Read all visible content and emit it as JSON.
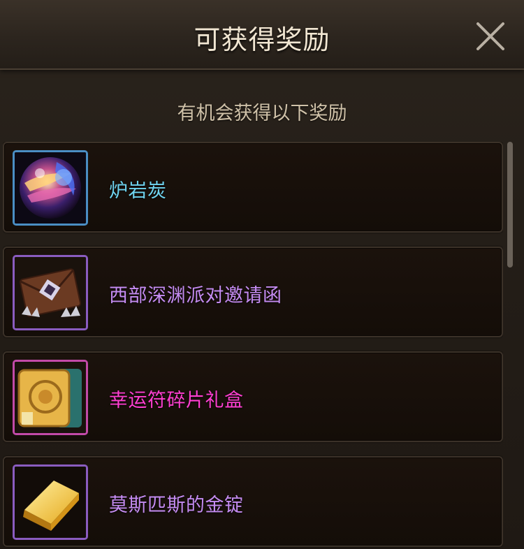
{
  "dialog": {
    "title": "可获得奖励",
    "subtitle": "有机会获得以下奖励",
    "close_icon": "close-icon"
  },
  "rewards": [
    {
      "name": "炉岩炭",
      "icon": "orb-icon",
      "rarity_color": "#6fd3ef",
      "frame_color": "#4a8ec4"
    },
    {
      "name": "西部深渊派对邀请函",
      "icon": "invitation-icon",
      "rarity_color": "#c58cf2",
      "frame_color": "#8a5cc0"
    },
    {
      "name": "幸运符碎片礼盒",
      "icon": "scroll-icon",
      "rarity_color": "#ff3fd2",
      "frame_color": "#c24aa8"
    },
    {
      "name": "莫斯匹斯的金锭",
      "icon": "gold-ingot-icon",
      "rarity_color": "#c58cf2",
      "frame_color": "#8a5cc0"
    }
  ]
}
